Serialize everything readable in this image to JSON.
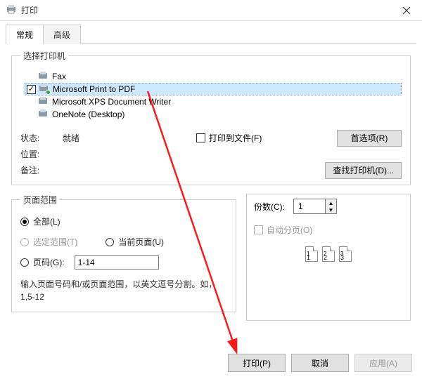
{
  "window": {
    "title": "打印"
  },
  "tabs": {
    "general": "常规",
    "advanced": "高级"
  },
  "printerSection": {
    "legend": "选择打印机",
    "items": [
      {
        "name": "Fax",
        "selected": false
      },
      {
        "name": "Microsoft Print to PDF",
        "selected": true
      },
      {
        "name": "Microsoft XPS Document Writer",
        "selected": false
      },
      {
        "name": "OneNote (Desktop)",
        "selected": false
      }
    ],
    "statusLabel": "状态:",
    "statusValue": "就绪",
    "locationLabel": "位置:",
    "commentLabel": "备注:",
    "printToFile": "打印到文件(F)",
    "prefsBtn": "首选项(R)",
    "findBtn": "查找打印机(D)..."
  },
  "range": {
    "legend": "页面范围",
    "all": "全部(L)",
    "selection": "选定范围(T)",
    "current": "当前页面(U)",
    "pages": "页码(G):",
    "pagesValue": "1-14",
    "hint": "输入页面号码和/或页面范围，以英文逗号分割。如，1,5-12"
  },
  "copies": {
    "label": "份数(C):",
    "value": "1",
    "collate": "自动分页(O)",
    "collateIcons": [
      "1",
      "1",
      "2",
      "2",
      "3",
      "3"
    ]
  },
  "footer": {
    "print": "打印(P)",
    "cancel": "取消",
    "apply": "应用(A)"
  }
}
